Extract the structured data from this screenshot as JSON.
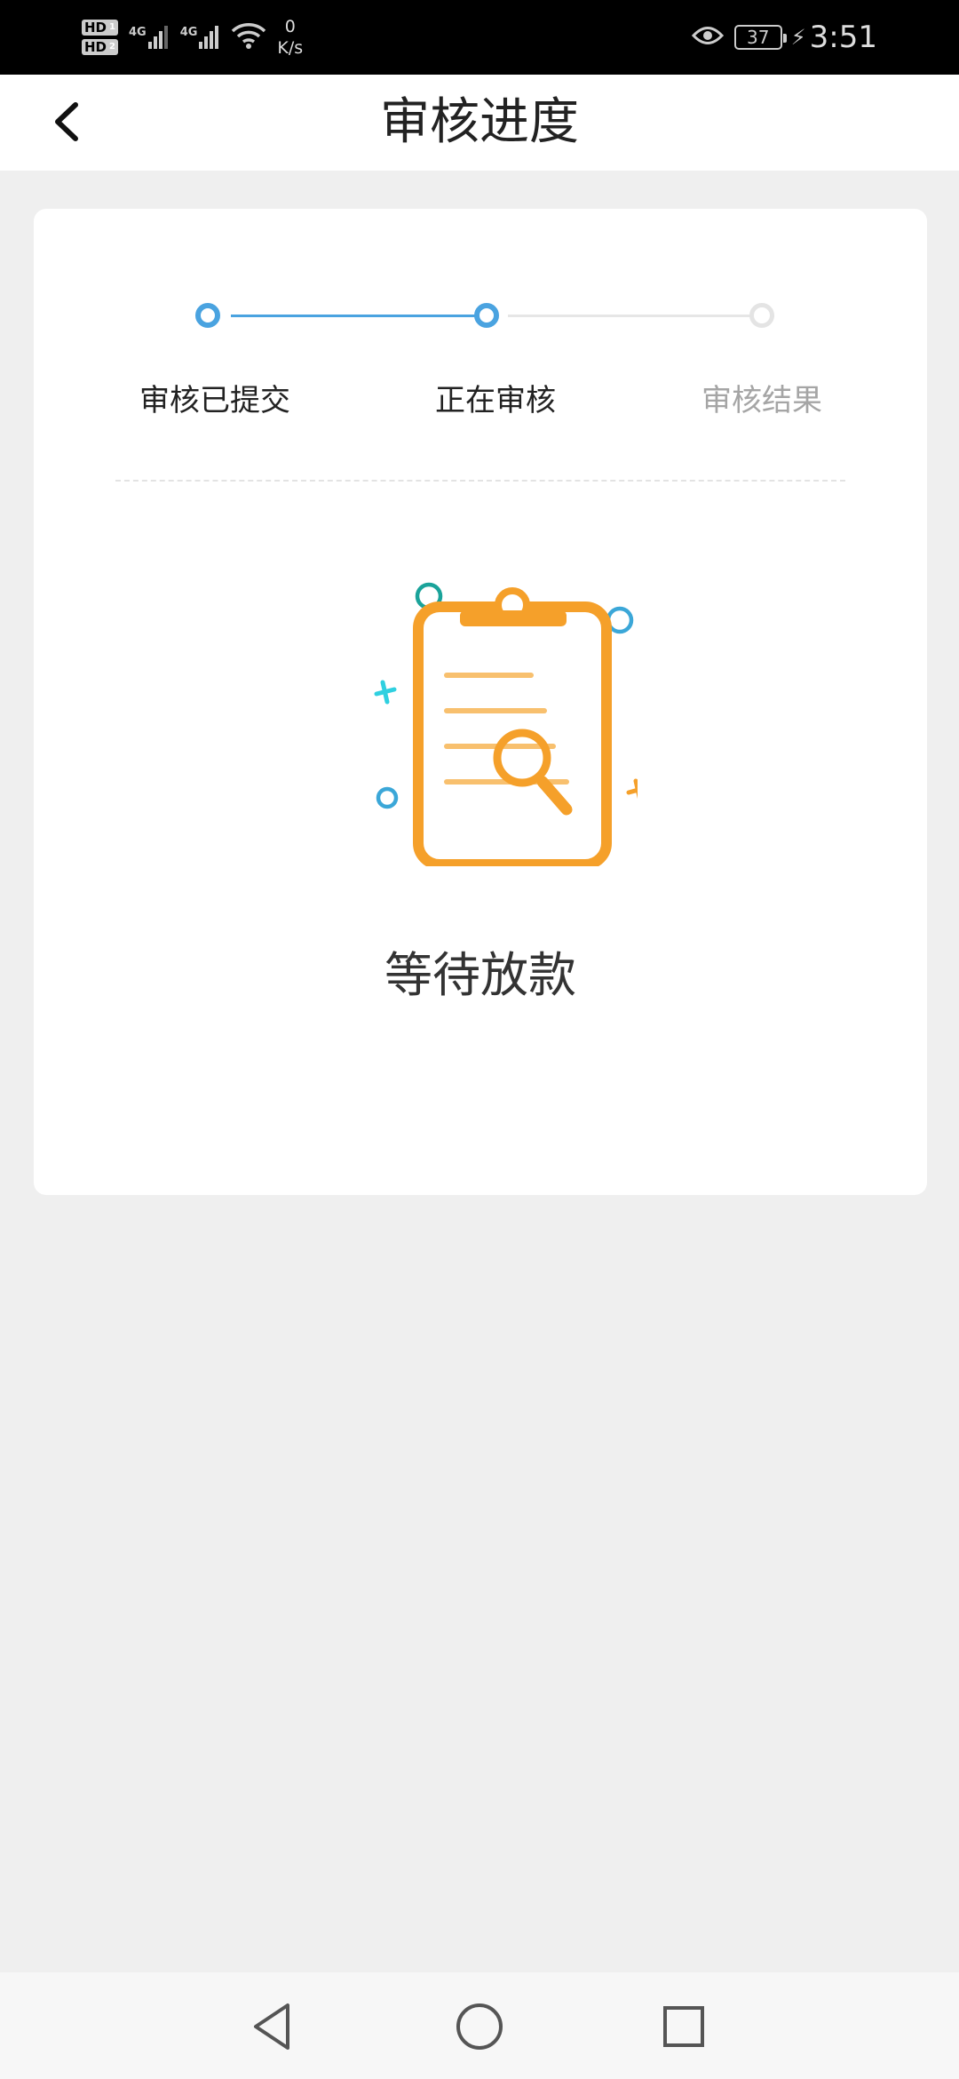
{
  "status_bar": {
    "hd1": "HD",
    "hd1_sub": "1",
    "hd2": "HD",
    "hd2_sub": "2",
    "net1": "4G",
    "net2": "4G",
    "speed_value": "0",
    "speed_unit": "K/s",
    "battery": "37",
    "time": "3:51",
    "icons": [
      "eye-icon",
      "wifi-icon",
      "signal-icon",
      "charging-icon"
    ]
  },
  "header": {
    "title": "审核进度",
    "back_icon": "chevron-left-icon"
  },
  "stepper": {
    "steps": [
      {
        "label": "审核已提交",
        "state": "done"
      },
      {
        "label": "正在审核",
        "state": "current"
      },
      {
        "label": "审核结果",
        "state": "pending"
      }
    ]
  },
  "status": {
    "illustration_icon": "clipboard-search-icon",
    "text": "等待放款"
  },
  "nav": {
    "back_icon": "triangle-back-icon",
    "home_icon": "circle-home-icon",
    "recent_icon": "square-recent-icon"
  },
  "colors": {
    "accent": "#4aa3e0",
    "inactive": "#e4e4e4",
    "illustration": "#f5a02a",
    "background": "#efefef"
  }
}
